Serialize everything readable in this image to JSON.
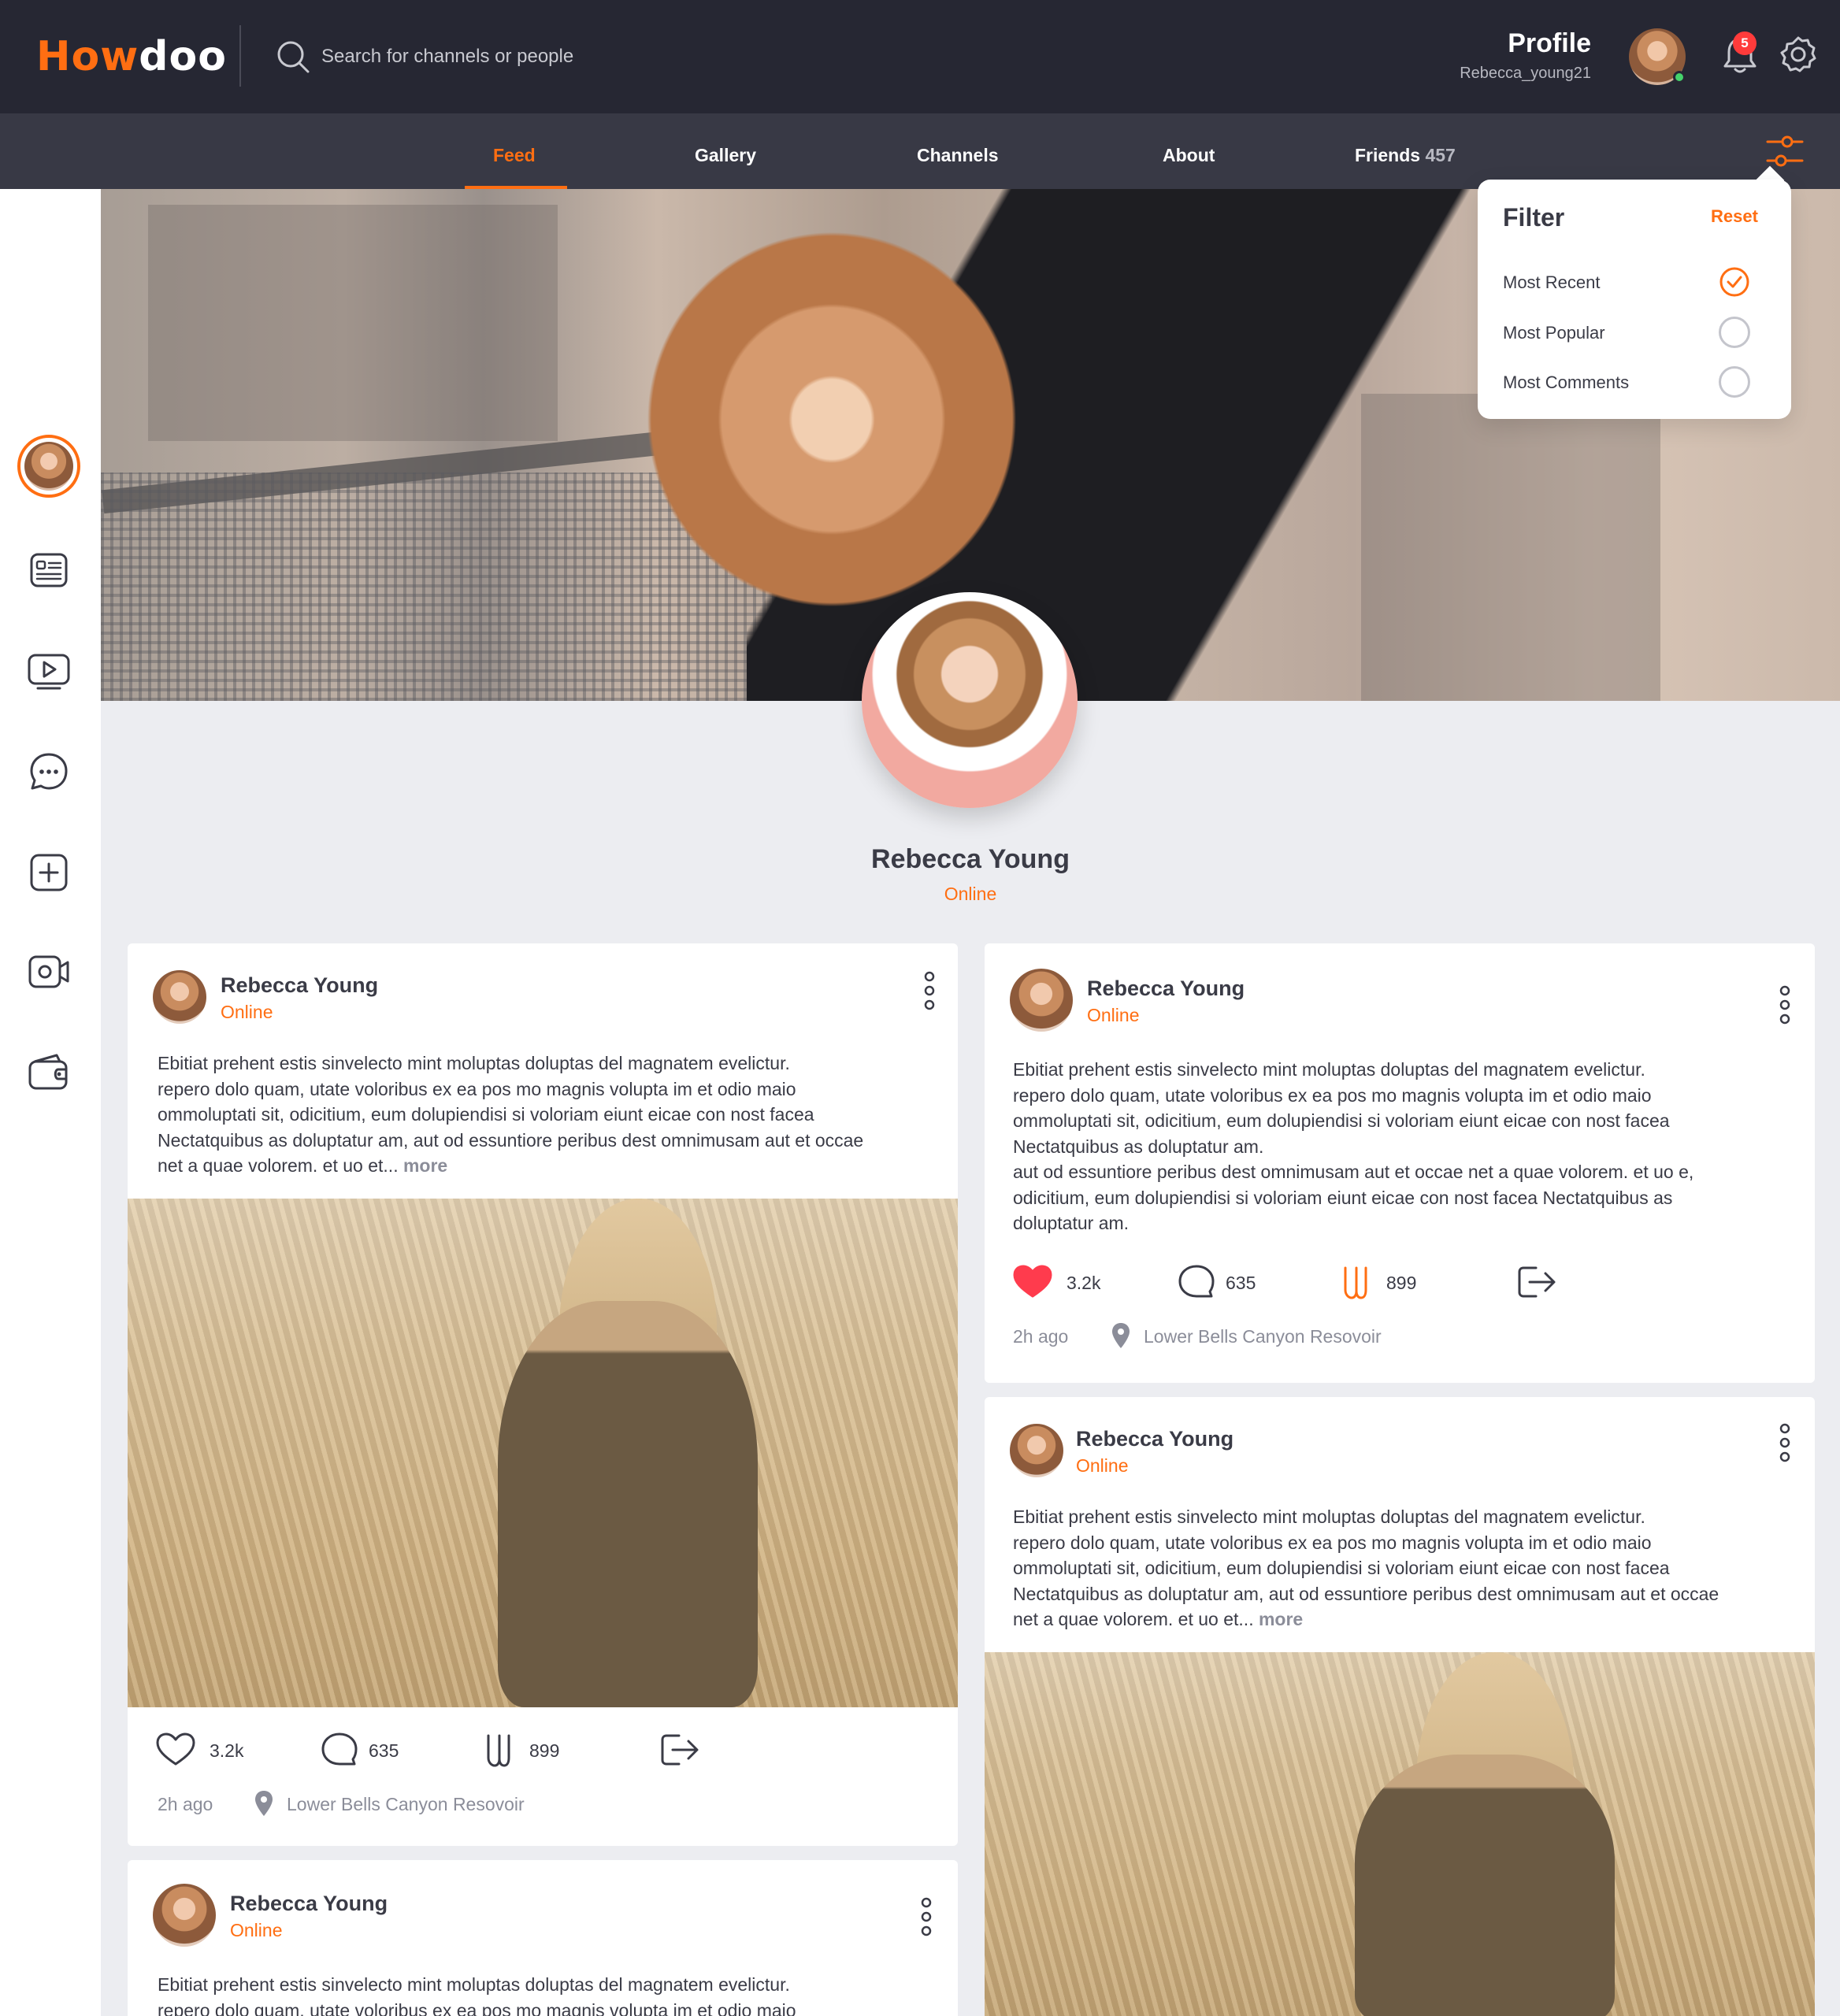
{
  "app": {
    "logo_brand": "How",
    "logo_rest": "doo",
    "search_placeholder": "Search for channels or people"
  },
  "header": {
    "profile_title": "Profile",
    "profile_handle": "Rebecca_young21",
    "notification_count": "5"
  },
  "tabs": [
    {
      "label": "Feed",
      "active": true
    },
    {
      "label": "Gallery"
    },
    {
      "label": "Channels"
    },
    {
      "label": "About"
    },
    {
      "label": "Friends",
      "count": "457"
    }
  ],
  "sidebar": {
    "icons": [
      "avatar",
      "news-icon",
      "video-play-icon",
      "chat-icon",
      "add-icon",
      "camera-icon",
      "wallet-icon"
    ]
  },
  "filter": {
    "title": "Filter",
    "reset_label": "Reset",
    "options": [
      {
        "label": "Most Recent",
        "checked": true
      },
      {
        "label": "Most Popular",
        "checked": false
      },
      {
        "label": "Most Comments",
        "checked": false
      }
    ]
  },
  "profile": {
    "name": "Rebecca Young",
    "status": "Online"
  },
  "posts": [
    {
      "author": "Rebecca Young",
      "status": "Online",
      "lines": [
        "Ebitiat prehent estis sinvelecto mint moluptas doluptas del magnatem evelictur.",
        "repero dolo quam, utate voloribus ex ea pos mo magnis volupta im et odio maio",
        "ommoluptati sit, odicitium, eum dolupiendisi si voloriam eiunt eicae con nost facea",
        "Nectatquibus as doluptatur am, aut od essuntiore peribus dest omnimusam aut et occae",
        "net a quae volorem. et uo et..."
      ],
      "more_label": "more",
      "likes": "3.2k",
      "comments": "635",
      "shares": "899",
      "time": "2h ago",
      "location": "Lower Bells Canyon Resovoir"
    },
    {
      "author": "Rebecca Young",
      "status": "Online",
      "lines": [
        "Ebitiat prehent estis sinvelecto mint moluptas doluptas del magnatem evelictur.",
        "repero dolo quam, utate voloribus ex ea pos mo magnis volupta im et odio maio",
        "ommoluptati sit, odicitium, eum dolupiendisi si voloriam eiunt eicae con nost facea",
        "Nectatquibus as doluptatur am.",
        "aut od essuntiore peribus dest omnimusam aut et occae net a quae volorem. et uo e,",
        "odicitium, eum dolupiendisi si voloriam eiunt eicae con nost facea Nectatquibus as",
        "doluptatur am."
      ],
      "likes": "3.2k",
      "comments": "635",
      "shares": "899",
      "time": "2h ago",
      "location": "Lower Bells Canyon Resovoir"
    },
    {
      "author": "Rebecca Young",
      "status": "Online",
      "lines": [
        "Ebitiat prehent estis sinvelecto mint moluptas doluptas del magnatem evelictur.",
        "repero dolo quam, utate voloribus ex ea pos mo magnis volupta im et odio maio",
        "ommoluptati sit, odicitium, eum dolupiendisi si voloriam eiunt eicae con nost facea",
        "Nectatquibus as doluptatur am, aut od essuntiore peribus dest omnimusam aut et occae",
        "net a quae volorem. et uo et..."
      ],
      "more_label": "more"
    },
    {
      "author": "Rebecca Young",
      "status": "Online",
      "lines": [
        "Ebitiat prehent estis sinvelecto mint moluptas doluptas del magnatem evelictur.",
        "repero dolo quam, utate voloribus ex ea pos mo magnis volupta im et odio maio"
      ]
    }
  ],
  "colors": {
    "accent": "#ff6e12",
    "topbar": "#262733",
    "tabbar": "#383945",
    "background": "#ecedf1",
    "like_active": "#ff3b4d"
  }
}
